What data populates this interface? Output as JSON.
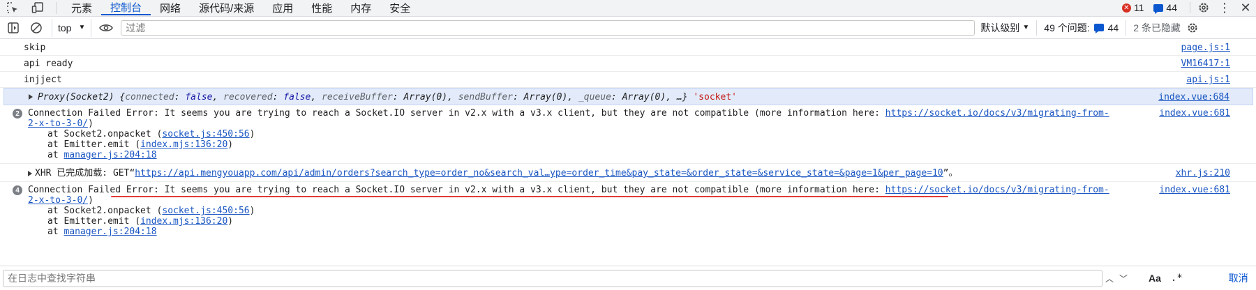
{
  "tabbar": {
    "tabs": [
      {
        "label": "元素"
      },
      {
        "label": "控制台",
        "active": true
      },
      {
        "label": "网络"
      },
      {
        "label": "源代码/来源"
      },
      {
        "label": "应用"
      },
      {
        "label": "性能"
      },
      {
        "label": "内存"
      },
      {
        "label": "安全"
      }
    ],
    "error_count": "11",
    "message_count": "44",
    "icons": [
      "inspect-element-icon",
      "device-toolbar-icon",
      "settings-gear-icon",
      "more-menu-icon",
      "close-icon"
    ]
  },
  "toolbar": {
    "context": "top",
    "filter_placeholder": "过滤",
    "levels_label": "默认级别",
    "issues_label": "49 个问题:",
    "issues_count": "44",
    "hidden_label": "2 条已隐藏"
  },
  "console": {
    "rows": [
      {
        "text": "skip",
        "source": "page.js:1"
      },
      {
        "text": "api ready",
        "source": "VM16417:1"
      },
      {
        "text": "injject",
        "source": "api.js:1"
      }
    ],
    "proxy": {
      "head": "Proxy(Socket2) {",
      "k1": "connected",
      "v1": "false",
      "k2": "recovered",
      "v2": "false",
      "k3": "receiveBuffer",
      "v3": "Array(0)",
      "k4": "sendBuffer",
      "v4": "Array(0)",
      "k5": "_queue",
      "v5": "Array(0)",
      "tail": "…}",
      "string": "'socket'",
      "source": "index.vue:684"
    },
    "error1": {
      "count": "2",
      "text": "Connection Failed Error: It seems you are trying to reach a Socket.IO server in v2.x with a v3.x client, but they are not compatible (more information here: ",
      "link1": "https://socket.io/docs/v3/migrating-from-",
      "link2": "2-x-to-3-0/",
      "link_close": ")",
      "stack": [
        {
          "prefix": "at Socket2.onpacket (",
          "link": "socket.js:450:56",
          "suffix": ")"
        },
        {
          "prefix": "at Emitter.emit (",
          "link": "index.mjs:136:20",
          "suffix": ")"
        },
        {
          "prefix": "at ",
          "link": "manager.js:204:18",
          "suffix": ""
        }
      ],
      "source": "index.vue:681"
    },
    "xhr": {
      "prefix": "XHR 已完成加载: GET“",
      "url": "https://api.mengyouapp.com/api/admin/orders?search_type=order_no&search_val…ype=order_time&pay_state=&order_state=&service_state=&page=1&per_page=10",
      "suffix": "”。",
      "source": "xhr.js:210"
    },
    "error2": {
      "count": "4",
      "text": "Connection Failed Error: It seems you are trying to reach a Socket.IO server in v2.x with a v3.x client, but they are not compatible (more information here: ",
      "link1": "https://socket.io/docs/v3/migrating-from-",
      "link2": "2-x-to-3-0/",
      "link_close": ")",
      "stack": [
        {
          "prefix": "at Socket2.onpacket (",
          "link": "socket.js:450:56",
          "suffix": ")"
        },
        {
          "prefix": "at Emitter.emit (",
          "link": "index.mjs:136:20",
          "suffix": ")"
        },
        {
          "prefix": "at ",
          "link": "manager.js:204:18",
          "suffix": ""
        }
      ],
      "source": "index.vue:681"
    }
  },
  "search": {
    "placeholder": "在日志中查找字符串",
    "match_case_label": "Aa",
    "regex_label": ".*",
    "cancel_label": "取消"
  },
  "colors": {
    "accent": "#0b57d0",
    "error": "#d93025",
    "link": "#1a56c2",
    "highlight_row": "#e3ebfa",
    "underline_annotation": "#e53935"
  }
}
